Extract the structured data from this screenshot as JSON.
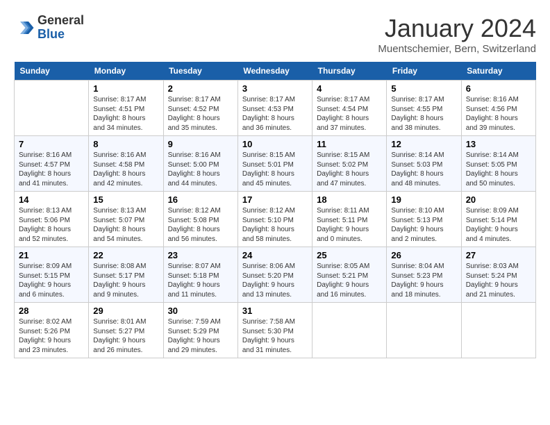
{
  "header": {
    "logo_general": "General",
    "logo_blue": "Blue",
    "month_title": "January 2024",
    "location": "Muentschemier, Bern, Switzerland"
  },
  "days_of_week": [
    "Sunday",
    "Monday",
    "Tuesday",
    "Wednesday",
    "Thursday",
    "Friday",
    "Saturday"
  ],
  "weeks": [
    [
      {
        "day": "",
        "sunrise": "",
        "sunset": "",
        "daylight": ""
      },
      {
        "day": "1",
        "sunrise": "Sunrise: 8:17 AM",
        "sunset": "Sunset: 4:51 PM",
        "daylight": "Daylight: 8 hours and 34 minutes."
      },
      {
        "day": "2",
        "sunrise": "Sunrise: 8:17 AM",
        "sunset": "Sunset: 4:52 PM",
        "daylight": "Daylight: 8 hours and 35 minutes."
      },
      {
        "day": "3",
        "sunrise": "Sunrise: 8:17 AM",
        "sunset": "Sunset: 4:53 PM",
        "daylight": "Daylight: 8 hours and 36 minutes."
      },
      {
        "day": "4",
        "sunrise": "Sunrise: 8:17 AM",
        "sunset": "Sunset: 4:54 PM",
        "daylight": "Daylight: 8 hours and 37 minutes."
      },
      {
        "day": "5",
        "sunrise": "Sunrise: 8:17 AM",
        "sunset": "Sunset: 4:55 PM",
        "daylight": "Daylight: 8 hours and 38 minutes."
      },
      {
        "day": "6",
        "sunrise": "Sunrise: 8:16 AM",
        "sunset": "Sunset: 4:56 PM",
        "daylight": "Daylight: 8 hours and 39 minutes."
      }
    ],
    [
      {
        "day": "7",
        "sunrise": "Sunrise: 8:16 AM",
        "sunset": "Sunset: 4:57 PM",
        "daylight": "Daylight: 8 hours and 41 minutes."
      },
      {
        "day": "8",
        "sunrise": "Sunrise: 8:16 AM",
        "sunset": "Sunset: 4:58 PM",
        "daylight": "Daylight: 8 hours and 42 minutes."
      },
      {
        "day": "9",
        "sunrise": "Sunrise: 8:16 AM",
        "sunset": "Sunset: 5:00 PM",
        "daylight": "Daylight: 8 hours and 44 minutes."
      },
      {
        "day": "10",
        "sunrise": "Sunrise: 8:15 AM",
        "sunset": "Sunset: 5:01 PM",
        "daylight": "Daylight: 8 hours and 45 minutes."
      },
      {
        "day": "11",
        "sunrise": "Sunrise: 8:15 AM",
        "sunset": "Sunset: 5:02 PM",
        "daylight": "Daylight: 8 hours and 47 minutes."
      },
      {
        "day": "12",
        "sunrise": "Sunrise: 8:14 AM",
        "sunset": "Sunset: 5:03 PM",
        "daylight": "Daylight: 8 hours and 48 minutes."
      },
      {
        "day": "13",
        "sunrise": "Sunrise: 8:14 AM",
        "sunset": "Sunset: 5:05 PM",
        "daylight": "Daylight: 8 hours and 50 minutes."
      }
    ],
    [
      {
        "day": "14",
        "sunrise": "Sunrise: 8:13 AM",
        "sunset": "Sunset: 5:06 PM",
        "daylight": "Daylight: 8 hours and 52 minutes."
      },
      {
        "day": "15",
        "sunrise": "Sunrise: 8:13 AM",
        "sunset": "Sunset: 5:07 PM",
        "daylight": "Daylight: 8 hours and 54 minutes."
      },
      {
        "day": "16",
        "sunrise": "Sunrise: 8:12 AM",
        "sunset": "Sunset: 5:08 PM",
        "daylight": "Daylight: 8 hours and 56 minutes."
      },
      {
        "day": "17",
        "sunrise": "Sunrise: 8:12 AM",
        "sunset": "Sunset: 5:10 PM",
        "daylight": "Daylight: 8 hours and 58 minutes."
      },
      {
        "day": "18",
        "sunrise": "Sunrise: 8:11 AM",
        "sunset": "Sunset: 5:11 PM",
        "daylight": "Daylight: 9 hours and 0 minutes."
      },
      {
        "day": "19",
        "sunrise": "Sunrise: 8:10 AM",
        "sunset": "Sunset: 5:13 PM",
        "daylight": "Daylight: 9 hours and 2 minutes."
      },
      {
        "day": "20",
        "sunrise": "Sunrise: 8:09 AM",
        "sunset": "Sunset: 5:14 PM",
        "daylight": "Daylight: 9 hours and 4 minutes."
      }
    ],
    [
      {
        "day": "21",
        "sunrise": "Sunrise: 8:09 AM",
        "sunset": "Sunset: 5:15 PM",
        "daylight": "Daylight: 9 hours and 6 minutes."
      },
      {
        "day": "22",
        "sunrise": "Sunrise: 8:08 AM",
        "sunset": "Sunset: 5:17 PM",
        "daylight": "Daylight: 9 hours and 9 minutes."
      },
      {
        "day": "23",
        "sunrise": "Sunrise: 8:07 AM",
        "sunset": "Sunset: 5:18 PM",
        "daylight": "Daylight: 9 hours and 11 minutes."
      },
      {
        "day": "24",
        "sunrise": "Sunrise: 8:06 AM",
        "sunset": "Sunset: 5:20 PM",
        "daylight": "Daylight: 9 hours and 13 minutes."
      },
      {
        "day": "25",
        "sunrise": "Sunrise: 8:05 AM",
        "sunset": "Sunset: 5:21 PM",
        "daylight": "Daylight: 9 hours and 16 minutes."
      },
      {
        "day": "26",
        "sunrise": "Sunrise: 8:04 AM",
        "sunset": "Sunset: 5:23 PM",
        "daylight": "Daylight: 9 hours and 18 minutes."
      },
      {
        "day": "27",
        "sunrise": "Sunrise: 8:03 AM",
        "sunset": "Sunset: 5:24 PM",
        "daylight": "Daylight: 9 hours and 21 minutes."
      }
    ],
    [
      {
        "day": "28",
        "sunrise": "Sunrise: 8:02 AM",
        "sunset": "Sunset: 5:26 PM",
        "daylight": "Daylight: 9 hours and 23 minutes."
      },
      {
        "day": "29",
        "sunrise": "Sunrise: 8:01 AM",
        "sunset": "Sunset: 5:27 PM",
        "daylight": "Daylight: 9 hours and 26 minutes."
      },
      {
        "day": "30",
        "sunrise": "Sunrise: 7:59 AM",
        "sunset": "Sunset: 5:29 PM",
        "daylight": "Daylight: 9 hours and 29 minutes."
      },
      {
        "day": "31",
        "sunrise": "Sunrise: 7:58 AM",
        "sunset": "Sunset: 5:30 PM",
        "daylight": "Daylight: 9 hours and 31 minutes."
      },
      {
        "day": "",
        "sunrise": "",
        "sunset": "",
        "daylight": ""
      },
      {
        "day": "",
        "sunrise": "",
        "sunset": "",
        "daylight": ""
      },
      {
        "day": "",
        "sunrise": "",
        "sunset": "",
        "daylight": ""
      }
    ]
  ]
}
